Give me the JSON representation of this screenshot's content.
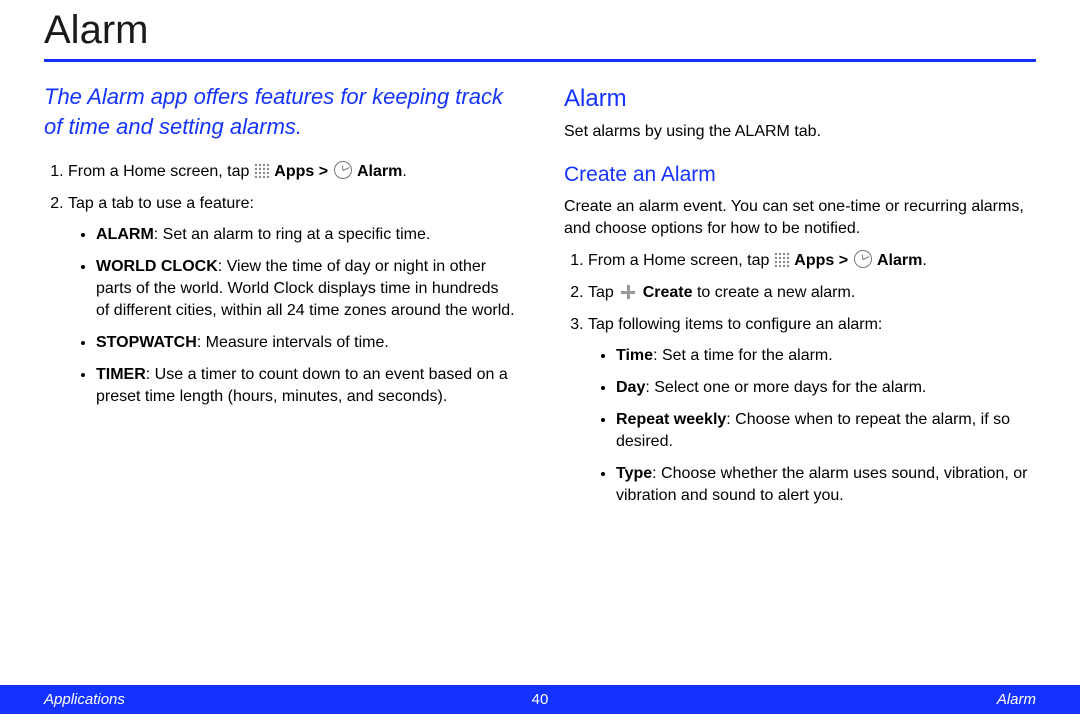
{
  "title": "Alarm",
  "intro": "The Alarm app offers features for keeping track of time and setting alarms.",
  "left": {
    "step1_a": "From a Home screen, tap ",
    "apps_label": "Apps",
    "gt": " > ",
    "alarm_label": "Alarm",
    "period": ".",
    "step2": "Tap a tab to use a feature:",
    "bullets": {
      "alarm_t": "ALARM",
      "alarm_d": ": Set an alarm to ring at a specific time.",
      "wc_t": "WORLD CLOCK",
      "wc_d": ": View the time of day or night in other parts of the world. World Clock displays time in hundreds of different cities, within all 24 time zones around the world.",
      "sw_t": "STOPWATCH",
      "sw_d": ": Measure intervals of time.",
      "tm_t": "TIMER",
      "tm_d": ": Use a timer to count down to an event based on a preset time length (hours, minutes, and seconds)."
    }
  },
  "right": {
    "h2": "Alarm",
    "sub": "Set alarms by using the ALARM tab.",
    "h3": "Create an Alarm",
    "desc": "Create an alarm event. You can set one-time or recurring alarms, and choose options for how to be notified.",
    "step1_a": "From a Home screen, tap ",
    "apps_label": "Apps",
    "gt": " > ",
    "alarm_label": "Alarm",
    "period": ".",
    "step2_a": "Tap ",
    "create_label": "Create",
    "step2_b": " to create a new alarm.",
    "step3": "Tap following items to configure an alarm:",
    "bullets": {
      "time_t": "Time",
      "time_d": ": Set a time for the alarm.",
      "day_t": "Day",
      "day_d": ": Select one or more days for the alarm.",
      "rep_t": "Repeat weekly",
      "rep_d": ": Choose when to repeat the alarm, if so desired.",
      "type_t": "Type",
      "type_d": ": Choose whether the alarm uses sound, vibration, or vibration and sound to alert you."
    }
  },
  "footer": {
    "left": "Applications",
    "page": "40",
    "right": "Alarm"
  }
}
